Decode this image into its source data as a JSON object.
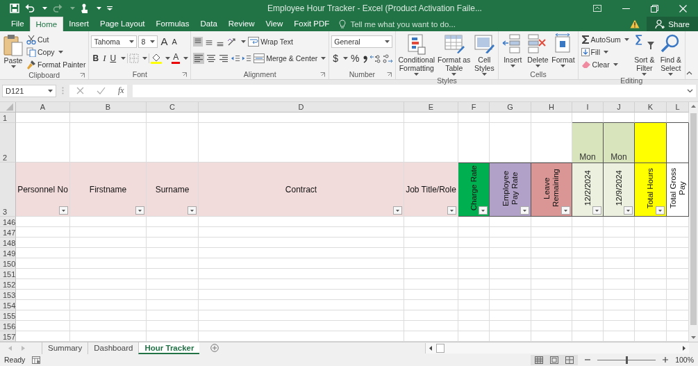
{
  "window": {
    "title": "Employee Hour Tracker - Excel (Product Activation Faile..."
  },
  "ribbon_tabs": [
    {
      "label": "File",
      "selected": false
    },
    {
      "label": "Home",
      "selected": true
    },
    {
      "label": "Insert",
      "selected": false
    },
    {
      "label": "Page Layout",
      "selected": false
    },
    {
      "label": "Formulas",
      "selected": false
    },
    {
      "label": "Data",
      "selected": false
    },
    {
      "label": "Review",
      "selected": false
    },
    {
      "label": "View",
      "selected": false
    },
    {
      "label": "Foxit PDF",
      "selected": false
    }
  ],
  "tell_me": {
    "placeholder": "Tell me what you want to do..."
  },
  "share": "Share",
  "ribbon": [
    {
      "kind": "clipboard",
      "label": "Clipboard",
      "paste": "Paste",
      "items": [
        "Cut",
        "Copy",
        "Format Painter"
      ]
    },
    {
      "kind": "font",
      "label": "Font",
      "font": "Tahoma",
      "size": "8",
      "grow": "A",
      "shrink": "A",
      "styles": [
        "B",
        "I",
        "U"
      ],
      "font_color": "A"
    },
    {
      "kind": "alignment",
      "label": "Alignment",
      "vertical_align": [
        {
          "selected": true
        },
        {
          "selected": false
        },
        {
          "selected": false
        }
      ],
      "horizontal_align": [
        {
          "selected": true
        },
        {
          "selected": false
        },
        {
          "selected": false
        }
      ],
      "wrap": "Wrap Text",
      "merge": "Merge & Center"
    },
    {
      "kind": "number",
      "label": "Number",
      "format": "General",
      "currency": "$",
      "percent": "%"
    },
    {
      "kind": "styles",
      "label": "Styles",
      "buttons": [
        {
          "lines": [
            "Conditional",
            "Formatting"
          ]
        },
        {
          "lines": [
            "Format as",
            "Table"
          ]
        },
        {
          "lines": [
            "Cell",
            "Styles"
          ]
        }
      ]
    },
    {
      "kind": "cells",
      "label": "Cells",
      "buttons": [
        {
          "lines": [
            "Insert"
          ]
        },
        {
          "lines": [
            "Delete"
          ]
        },
        {
          "lines": [
            "Format"
          ]
        }
      ]
    },
    {
      "kind": "editing",
      "label": "Editing",
      "items": [
        "AutoSum",
        "Fill",
        "Clear"
      ],
      "buttons": [
        {
          "lines": [
            "Sort &",
            "Filter"
          ]
        },
        {
          "lines": [
            "Find &",
            "Select"
          ]
        }
      ]
    }
  ],
  "name_box": "D121",
  "function_label": "fx",
  "rows": [
    "1",
    "2",
    "3",
    "146",
    "147",
    "148",
    "149",
    "150",
    "151",
    "152",
    "153",
    "154",
    "155",
    "156",
    "157"
  ],
  "columns": [
    {
      "letter": "A",
      "header": "Personnel No",
      "kind": "horizontal",
      "color": "#f2dcdb",
      "filter": true
    },
    {
      "letter": "B",
      "header": "Firstname",
      "kind": "horizontal",
      "color": "#f2dcdb",
      "filter": true
    },
    {
      "letter": "C",
      "header": "Surname",
      "kind": "horizontal",
      "color": "#f2dcdb",
      "filter": true
    },
    {
      "letter": "D",
      "header": "Contract",
      "kind": "horizontal",
      "color": "#f2dcdb",
      "filter": true
    },
    {
      "letter": "E",
      "header": "Job Title/Role",
      "kind": "horizontal",
      "color": "#f2dcdb",
      "filter": true
    },
    {
      "letter": "F",
      "header": "Charge Rate",
      "kind": "vertical",
      "color": "#00b050",
      "filter": true
    },
    {
      "letter": "G",
      "header": "Employee Pay Rate",
      "kind": "vertical",
      "color": "#b1a0c7",
      "filter": true
    },
    {
      "letter": "H",
      "header": "Leave Remaining",
      "kind": "vertical",
      "color": "#da9694",
      "filter": true
    },
    {
      "letter": "I",
      "header": "12/2/2024",
      "kind": "vertical",
      "color": "#ebf1de",
      "filter": true,
      "day": {
        "text": "Mon",
        "color": "#d8e4bc"
      }
    },
    {
      "letter": "J",
      "header": "12/9/2024",
      "kind": "vertical",
      "color": "#ebf1de",
      "filter": true,
      "day": {
        "text": "Mon",
        "color": "#d8e4bc"
      }
    },
    {
      "letter": "K",
      "header": "Total Hours",
      "kind": "vertical",
      "color": "#ffff00",
      "filter": true,
      "day": {
        "color": "#ffff00"
      }
    },
    {
      "letter": "L",
      "header": "Total Gross Pay",
      "kind": "vertical",
      "color": "#ffffff",
      "filter": false,
      "day": {
        "color": "#ffffff"
      }
    }
  ],
  "sheet_tabs": [
    {
      "label": "Summary",
      "selected": false
    },
    {
      "label": "Dashboard",
      "selected": false
    },
    {
      "label": "Hour Tracker",
      "selected": true
    }
  ],
  "status": "Ready",
  "zoom": {
    "level": 0.5,
    "reading": "100%"
  }
}
